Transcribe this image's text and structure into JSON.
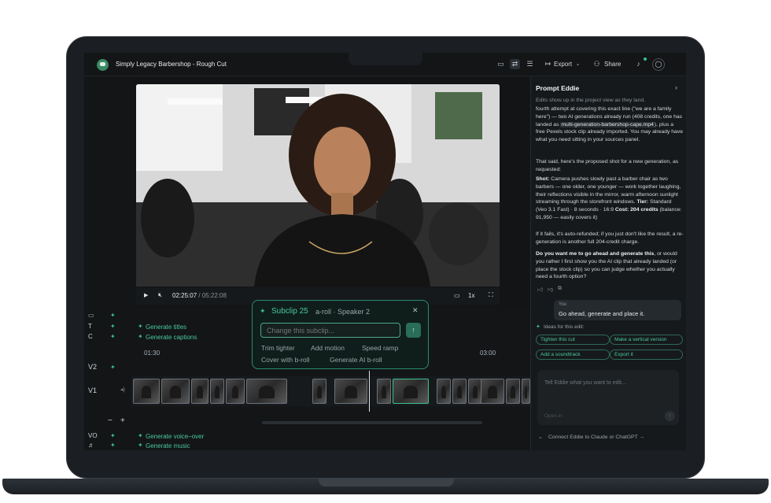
{
  "app": {
    "project_title": "Simply Legacy Barbershop - Rough Cut"
  },
  "toolbar": {
    "export_label": "Export",
    "share_label": "Share"
  },
  "player": {
    "current_time": "02:25:07",
    "separator": " / ",
    "total_time": "05:22:08",
    "speed": "1x"
  },
  "timeline": {
    "track_labels": {
      "t": "T",
      "c": "C",
      "v2": "V2",
      "v1": "V1",
      "vo": "VO"
    },
    "generate_titles": "Generate titles",
    "generate_captions": "Generate captions",
    "generate_voiceover": "Generate voice–over",
    "generate_music": "Generate music",
    "ruler_marks": [
      "01:30",
      "03:00"
    ]
  },
  "subclip_popup": {
    "title": "Subclip 25",
    "meta": "a-roll · Speaker 2",
    "placeholder": "Change this subclip...",
    "actions": [
      "Trim tighter",
      "Add motion",
      "Speed ramp",
      "Cover with b-roll",
      "Generate AI b-roll"
    ]
  },
  "panel": {
    "title": "Prompt Eddie",
    "subtitle": "Edits show up in the project view as they land.",
    "msg_p1_a": "fourth attempt at covering this exact line (\"we are a family here\") — two AI generations already run (408 credits, one has landed as ",
    "msg_p1_file": "multi-generation-barbershop-cape.mp4",
    "msg_p1_b": "), plus a free Pexels stock clip already imported. You may already have what you need sitting in your sources panel.",
    "msg_p2": "That said, here's the proposed shot for a new generation, as requested:",
    "shot_label": "Shot:",
    "shot_text": " Camera pushes slowly past a barber chair as two barbers — one older, one younger — work together laughing, their reflections visible in the mirror, warm afternoon sunlight streaming through the storefront windows. ",
    "tier_label": "Tier:",
    "tier_text": " Standard (Veo 3.1 Fast) · 8 seconds · 16:9 ",
    "cost_label": "Cost: 204 credits",
    "cost_text": " (balance: 91,950 — easily covers it)",
    "refund_text": "If it fails, it's auto-refunded; if you just don't like the result, a re-generation is another full 204-credit charge.",
    "question_bold": "Do you want me to go ahead and generate this",
    "question_rest": ", or would you rather I first show you the AI clip that already landed (or place the stock clip) so you can judge whether you actually need a fourth option?",
    "user_label": "You",
    "user_msg": "Go ahead, generate and place it.",
    "ideas_label": "Ideas for this edit:",
    "chips": [
      "Tighten this cut",
      "Make a vertical version",
      "Add a soundtrack",
      "Export it"
    ],
    "input_placeholder": "Tell Eddie what you want to edit...",
    "open_in": "Open in",
    "connect_text": "Connect Eddie to Claude or ChatGPT →"
  },
  "colors": {
    "accent": "#39c08b",
    "background": "#121416"
  }
}
